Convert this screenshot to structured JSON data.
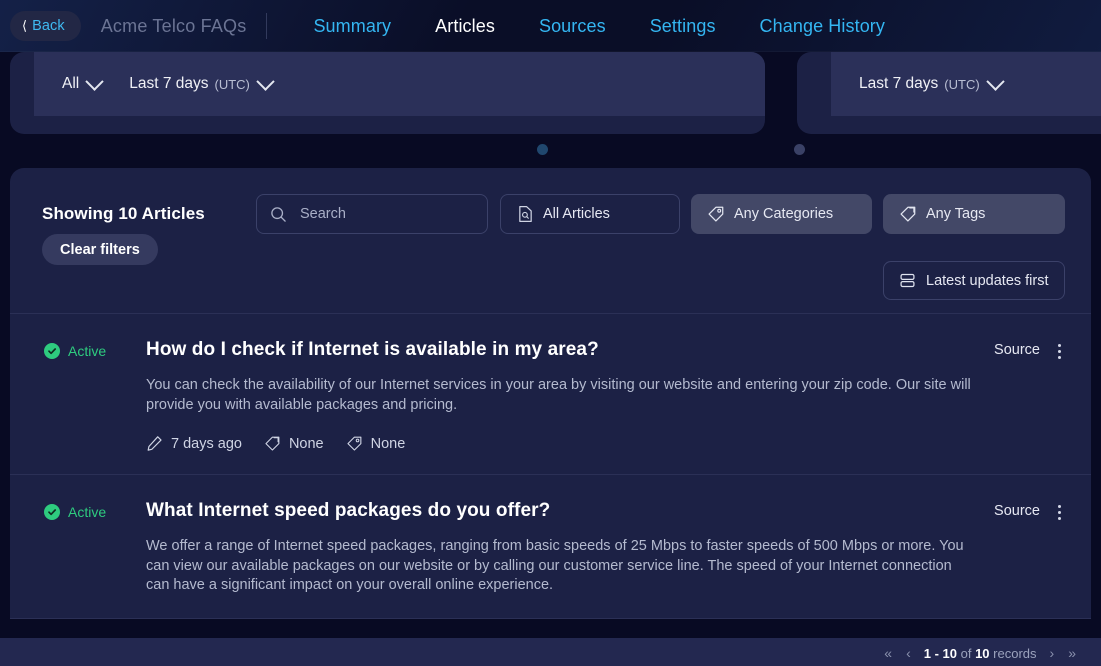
{
  "header": {
    "back_label": "Back",
    "app_title": "Acme Telco FAQs",
    "nav": [
      {
        "label": "Summary",
        "active": false
      },
      {
        "label": "Articles",
        "active": true
      },
      {
        "label": "Sources",
        "active": false
      },
      {
        "label": "Settings",
        "active": false
      },
      {
        "label": "Change History",
        "active": false
      }
    ]
  },
  "range_cards": [
    {
      "scope_label": "All",
      "date_label": "Last 7 days",
      "date_sub": "(UTC)"
    },
    {
      "date_label": "Last 7 days",
      "date_sub": "(UTC)"
    }
  ],
  "filters": {
    "showing_text": "Showing 10 Articles",
    "clear_filters_label": "Clear filters",
    "search_placeholder": "Search",
    "search_value": "",
    "articles_filter_label": "All Articles",
    "categories_filter_label": "Any Categories",
    "tags_filter_label": "Any Tags",
    "sort_label": "Latest updates first"
  },
  "articles": [
    {
      "status": "Active",
      "title": "How do I check if Internet is available in my area?",
      "snippet": "You can check the availability of our Internet services in your area by visiting our website and entering your zip code. Our site will provide you with available packages and pricing.",
      "updated": "7 days ago",
      "categories": "None",
      "tags": "None",
      "source_label": "Source"
    },
    {
      "status": "Active",
      "title": "What Internet speed packages do you offer?",
      "snippet": "We offer a range of Internet speed packages, ranging from basic speeds of 25 Mbps to faster speeds of 500 Mbps or more. You can view our available packages on our website or by calling our customer service line. The speed of your Internet connection can have a significant impact on your overall online experience.",
      "source_label": "Source"
    }
  ],
  "pagination": {
    "first": "«",
    "prev": "‹",
    "range": "1 - 10",
    "of": "of",
    "total": "10",
    "records_label": "records",
    "next": "›",
    "last": "»"
  },
  "colors": {
    "page_bg": "#080a23",
    "card_bg": "#1c2145",
    "accent_link": "#34b6f2",
    "status_green": "#2ecb7f",
    "pill_filled": "#434867"
  }
}
